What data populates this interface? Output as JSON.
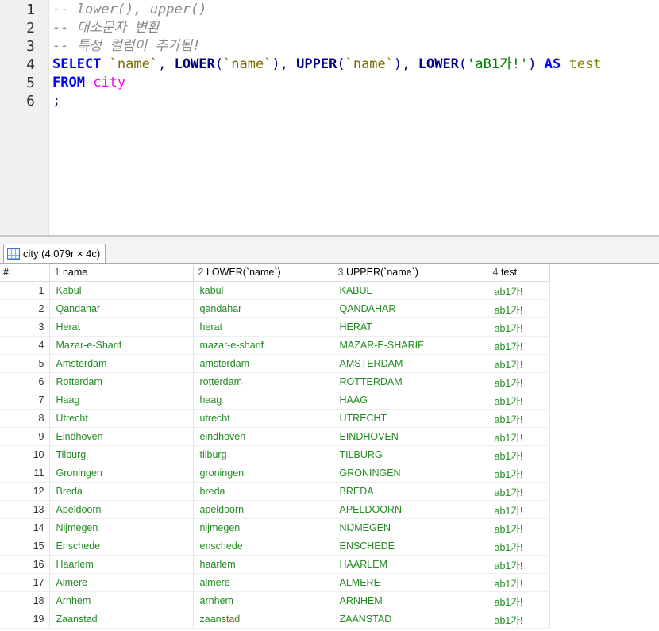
{
  "editor": {
    "line_numbers": [
      "1",
      "2",
      "3",
      "4",
      "5",
      "6"
    ],
    "comment1": "-- lower(), upper()",
    "comment2": "-- 대소문자 변환",
    "comment3": "-- 특정 컬럼이 추가됨!",
    "line4": {
      "kw_select": "SELECT",
      "col1": "`name`",
      "sep1": ", ",
      "fn_lower": "LOWER",
      "paren_open": "(",
      "col2": "`name`",
      "paren_close_sep": "), ",
      "fn_upper": "UPPER",
      "paren_open2": "(",
      "col3": "`name`",
      "paren_close_sep2": "), ",
      "fn_lower2": "LOWER",
      "paren_open3": "(",
      "str_literal": "'aB1가!'",
      "paren_close3": ")",
      "kw_as": "AS",
      "alias": "test"
    },
    "line5": {
      "kw_from": "FROM",
      "table": "city"
    },
    "line6": ";"
  },
  "result_tab": {
    "label": "city (4,079r × 4c)",
    "icon": "table-grid-icon"
  },
  "grid": {
    "row_header": "#",
    "columns": [
      {
        "num": "1",
        "name": "name"
      },
      {
        "num": "2",
        "name": "LOWER(`name`)"
      },
      {
        "num": "3",
        "name": "UPPER(`name`)"
      },
      {
        "num": "4",
        "name": "test"
      }
    ],
    "rows": [
      [
        "1",
        "Kabul",
        "kabul",
        "KABUL",
        "ab1가!"
      ],
      [
        "2",
        "Qandahar",
        "qandahar",
        "QANDAHAR",
        "ab1가!"
      ],
      [
        "3",
        "Herat",
        "herat",
        "HERAT",
        "ab1가!"
      ],
      [
        "4",
        "Mazar-e-Sharif",
        "mazar-e-sharif",
        "MAZAR-E-SHARIF",
        "ab1가!"
      ],
      [
        "5",
        "Amsterdam",
        "amsterdam",
        "AMSTERDAM",
        "ab1가!"
      ],
      [
        "6",
        "Rotterdam",
        "rotterdam",
        "ROTTERDAM",
        "ab1가!"
      ],
      [
        "7",
        "Haag",
        "haag",
        "HAAG",
        "ab1가!"
      ],
      [
        "8",
        "Utrecht",
        "utrecht",
        "UTRECHT",
        "ab1가!"
      ],
      [
        "9",
        "Eindhoven",
        "eindhoven",
        "EINDHOVEN",
        "ab1가!"
      ],
      [
        "10",
        "Tilburg",
        "tilburg",
        "TILBURG",
        "ab1가!"
      ],
      [
        "11",
        "Groningen",
        "groningen",
        "GRONINGEN",
        "ab1가!"
      ],
      [
        "12",
        "Breda",
        "breda",
        "BREDA",
        "ab1가!"
      ],
      [
        "13",
        "Apeldoorn",
        "apeldoorn",
        "APELDOORN",
        "ab1가!"
      ],
      [
        "14",
        "Nijmegen",
        "nijmegen",
        "NIJMEGEN",
        "ab1가!"
      ],
      [
        "15",
        "Enschede",
        "enschede",
        "ENSCHEDE",
        "ab1가!"
      ],
      [
        "16",
        "Haarlem",
        "haarlem",
        "HAARLEM",
        "ab1가!"
      ],
      [
        "17",
        "Almere",
        "almere",
        "ALMERE",
        "ab1가!"
      ],
      [
        "18",
        "Arnhem",
        "arnhem",
        "ARNHEM",
        "ab1가!"
      ],
      [
        "19",
        "Zaanstad",
        "zaanstad",
        "ZAANSTAD",
        "ab1가!"
      ]
    ]
  },
  "colors": {
    "keyword": "#0000ff",
    "function": "#000080",
    "comment": "#8a8a8a",
    "table_name": "#ff00ff",
    "cell_text": "#228b22"
  }
}
